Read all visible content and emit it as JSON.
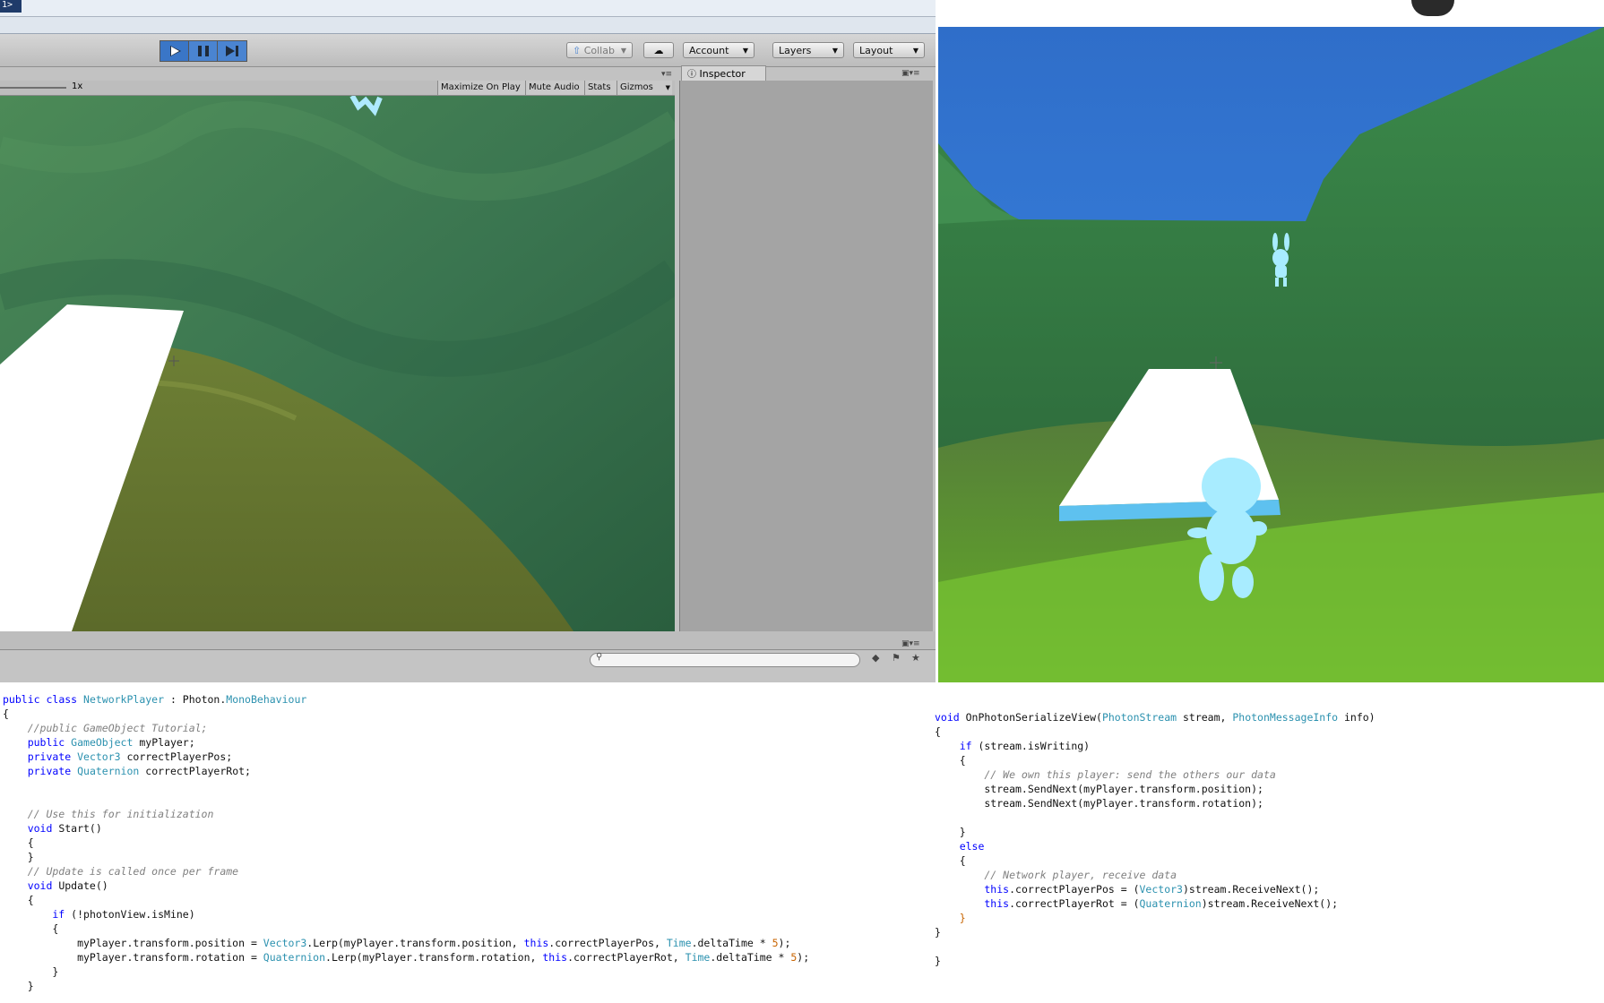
{
  "ide_title": "1>",
  "toolbar": {
    "play_icon": "play-icon",
    "pause_icon": "pause-icon",
    "step_icon": "step-icon",
    "collab_label": "Collab",
    "account_label": "Account",
    "layers_label": "Layers",
    "layout_label": "Layout"
  },
  "game_view": {
    "scale_label": "1x",
    "maximize_label": "Maximize On Play",
    "mute_label": "Mute Audio",
    "stats_label": "Stats",
    "gizmos_label": "Gizmos"
  },
  "inspector": {
    "tab_label": "Inspector"
  },
  "colors": {
    "keyword": "#0000ff",
    "type": "#2b91af",
    "comment": "#808080",
    "number": "#c86400",
    "play_active": "#3a76c7"
  },
  "code_left": {
    "lines": [
      [
        [
          "kw",
          "public "
        ],
        [
          "kw",
          "class "
        ],
        [
          "ty",
          "NetworkPlayer"
        ],
        [
          "tx",
          " : Photon."
        ],
        [
          "ty",
          "MonoBehaviour"
        ]
      ],
      [
        [
          "tx",
          "{"
        ]
      ],
      [
        [
          "cm",
          "    //public GameObject Tutorial;"
        ]
      ],
      [
        [
          "kw",
          "    public "
        ],
        [
          "ty",
          "GameObject"
        ],
        [
          "tx",
          " myPlayer;"
        ]
      ],
      [
        [
          "kw",
          "    private "
        ],
        [
          "ty",
          "Vector3"
        ],
        [
          "tx",
          " correctPlayerPos;"
        ]
      ],
      [
        [
          "kw",
          "    private "
        ],
        [
          "ty",
          "Quaternion"
        ],
        [
          "tx",
          " correctPlayerRot;"
        ]
      ],
      [
        [
          "tx",
          ""
        ]
      ],
      [
        [
          "tx",
          ""
        ]
      ],
      [
        [
          "cm",
          "    // Use this for initialization"
        ]
      ],
      [
        [
          "kw",
          "    void "
        ],
        [
          "tx",
          "Start()"
        ]
      ],
      [
        [
          "tx",
          "    {"
        ]
      ],
      [
        [
          "tx",
          "    }"
        ]
      ],
      [
        [
          "cm",
          "    // Update is called once per frame"
        ]
      ],
      [
        [
          "kw",
          "    void "
        ],
        [
          "tx",
          "Update()"
        ]
      ],
      [
        [
          "tx",
          "    {"
        ]
      ],
      [
        [
          "kw",
          "        if "
        ],
        [
          "tx",
          "(!photonView.isMine)"
        ]
      ],
      [
        [
          "tx",
          "        {"
        ]
      ],
      [
        [
          "tx",
          "            myPlayer.transform.position = "
        ],
        [
          "ty",
          "Vector3"
        ],
        [
          "tx",
          ".Lerp(myPlayer.transform.position, "
        ],
        [
          "kw",
          "this"
        ],
        [
          "tx",
          ".correctPlayerPos, "
        ],
        [
          "ty",
          "Time"
        ],
        [
          "tx",
          ".deltaTime * "
        ],
        [
          "nm",
          "5"
        ],
        [
          "tx",
          ");"
        ]
      ],
      [
        [
          "tx",
          "            myPlayer.transform.rotation = "
        ],
        [
          "ty",
          "Quaternion"
        ],
        [
          "tx",
          ".Lerp(myPlayer.transform.rotation, "
        ],
        [
          "kw",
          "this"
        ],
        [
          "tx",
          ".correctPlayerRot, "
        ],
        [
          "ty",
          "Time"
        ],
        [
          "tx",
          ".deltaTime * "
        ],
        [
          "nm",
          "5"
        ],
        [
          "tx",
          ");"
        ]
      ],
      [
        [
          "tx",
          "        }"
        ]
      ],
      [
        [
          "tx",
          "    }"
        ]
      ]
    ]
  },
  "code_right": {
    "lines": [
      [
        [
          "kw",
          "void "
        ],
        [
          "tx",
          "OnPhotonSerializeView("
        ],
        [
          "ty",
          "PhotonStream"
        ],
        [
          "tx",
          " stream, "
        ],
        [
          "ty",
          "PhotonMessageInfo"
        ],
        [
          "tx",
          " info)"
        ]
      ],
      [
        [
          "tx",
          "{"
        ]
      ],
      [
        [
          "kw",
          "    if "
        ],
        [
          "tx",
          "(stream.isWriting)"
        ]
      ],
      [
        [
          "tx",
          "    {"
        ]
      ],
      [
        [
          "cm",
          "        // We own this player: send the others our data"
        ]
      ],
      [
        [
          "tx",
          "        stream.SendNext(myPlayer.transform.position);"
        ]
      ],
      [
        [
          "tx",
          "        stream.SendNext(myPlayer.transform.rotation);"
        ]
      ],
      [
        [
          "tx",
          ""
        ]
      ],
      [
        [
          "tx",
          "    }"
        ]
      ],
      [
        [
          "kw",
          "    else"
        ]
      ],
      [
        [
          "tx",
          "    {"
        ]
      ],
      [
        [
          "cm",
          "        // Network player, receive data"
        ]
      ],
      [
        [
          "kw",
          "        this"
        ],
        [
          "tx",
          ".correctPlayerPos = ("
        ],
        [
          "ty",
          "Vector3"
        ],
        [
          "tx",
          ")stream.ReceiveNext();"
        ]
      ],
      [
        [
          "kw",
          "        this"
        ],
        [
          "tx",
          ".correctPlayerRot = ("
        ],
        [
          "ty",
          "Quaternion"
        ],
        [
          "tx",
          ")stream.ReceiveNext();"
        ]
      ],
      [
        [
          "nm",
          "    }"
        ]
      ],
      [
        [
          "tx",
          "}"
        ]
      ],
      [
        [
          "tx",
          ""
        ]
      ],
      [
        [
          "tx",
          "}"
        ]
      ]
    ]
  }
}
